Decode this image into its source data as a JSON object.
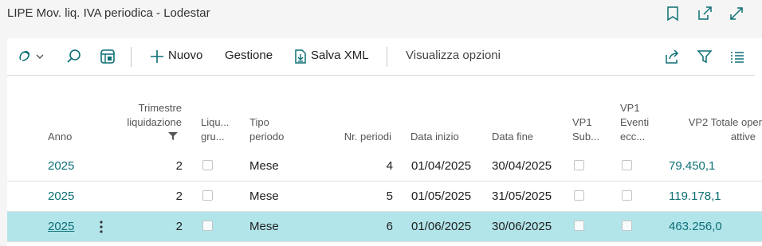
{
  "window": {
    "title": "LIPE Mov. liq. IVA periodica - Lodestar"
  },
  "actions": {
    "nuovo": "Nuovo",
    "gestione": "Gestione",
    "salva_xml": "Salva XML",
    "visualizza": "Visualizza opzioni"
  },
  "columns": {
    "anno": "Anno",
    "trimestre": [
      "Trimestre",
      "liquidazione"
    ],
    "liqu": [
      "Liqu...",
      "gru..."
    ],
    "tipo": [
      "Tipo",
      "periodo"
    ],
    "nr_periodi": "Nr. periodi",
    "data_inizio": "Data inizio",
    "data_fine": "Data fine",
    "vp1_sub": [
      "VP1",
      "Sub..."
    ],
    "vp1_eventi": [
      "VP1",
      "Eventi",
      "ecc..."
    ],
    "vp2": [
      "VP2 Totale oper",
      "attive"
    ]
  },
  "rows": [
    {
      "anno": "2025",
      "trimestre": "2",
      "tipo": "Mese",
      "nr": "4",
      "inizio": "01/04/2025",
      "fine": "30/04/2025",
      "vp2": "79.450,1"
    },
    {
      "anno": "2025",
      "trimestre": "2",
      "tipo": "Mese",
      "nr": "5",
      "inizio": "01/05/2025",
      "fine": "31/05/2025",
      "vp2": "119.178,1"
    },
    {
      "anno": "2025",
      "trimestre": "2",
      "tipo": "Mese",
      "nr": "6",
      "inizio": "01/06/2025",
      "fine": "30/06/2025",
      "vp2": "463.256,0"
    }
  ],
  "colors": {
    "accent": "#0d6f75",
    "selected_row": "#b2e5ea"
  }
}
